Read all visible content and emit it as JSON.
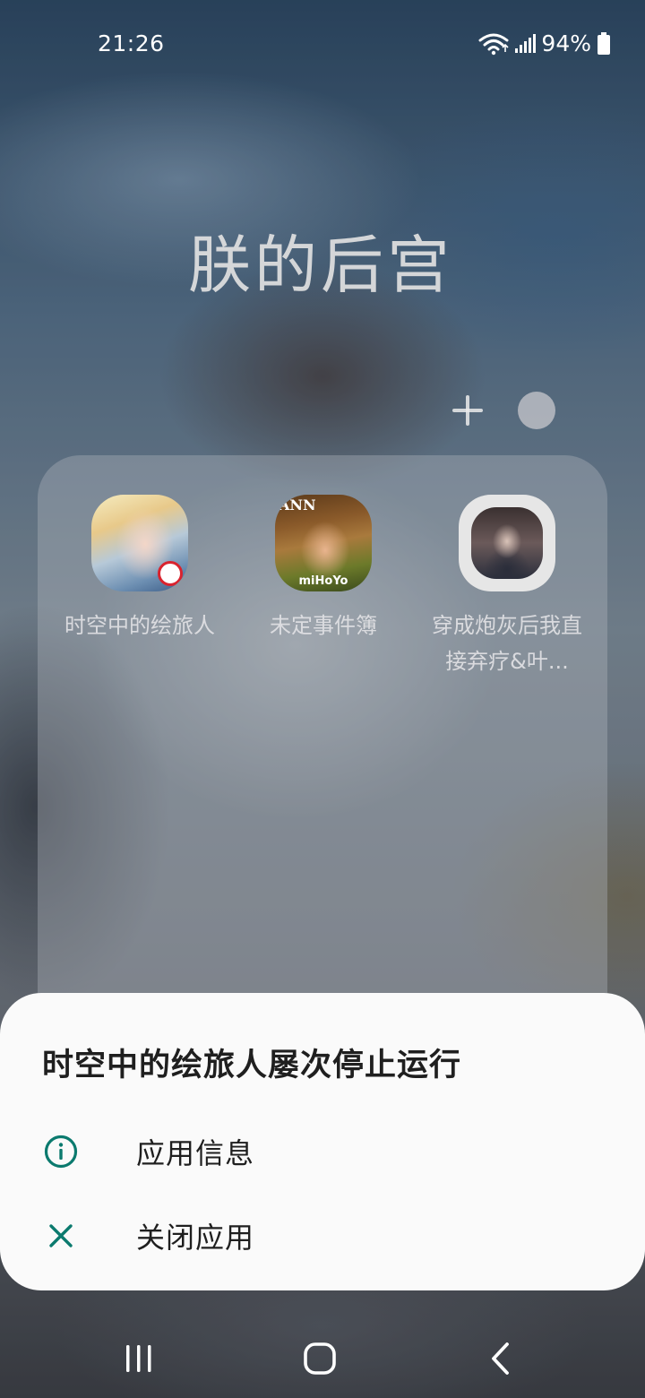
{
  "status_bar": {
    "time": "21:26",
    "battery_percent": "94%",
    "icons": [
      "wifi-icon",
      "signal-icon",
      "battery-icon"
    ]
  },
  "folder": {
    "title": "朕的后宫",
    "add_icon": "plus-icon",
    "color_picker_icon": "circle-icon",
    "apps": [
      {
        "label": "时空中的绘旅人",
        "icon": "app-icon-paintingwalker"
      },
      {
        "label": "未定事件簿",
        "icon": "app-icon-tearsofthemis"
      },
      {
        "label": "穿成炮灰后我直接弃疗&叶...",
        "icon": "app-icon-novel"
      }
    ]
  },
  "icon_text": {
    "app2_top": "ANN",
    "app2_bottom": "miHoYo"
  },
  "dialog": {
    "title": "时空中的绘旅人屡次停止运行",
    "options": [
      {
        "label": "应用信息",
        "icon": "info-icon"
      },
      {
        "label": "关闭应用",
        "icon": "close-icon"
      }
    ],
    "accent_color": "#0b7a6e"
  },
  "nav_bar": {
    "buttons": [
      "recent-apps-icon",
      "home-icon",
      "back-icon"
    ]
  }
}
